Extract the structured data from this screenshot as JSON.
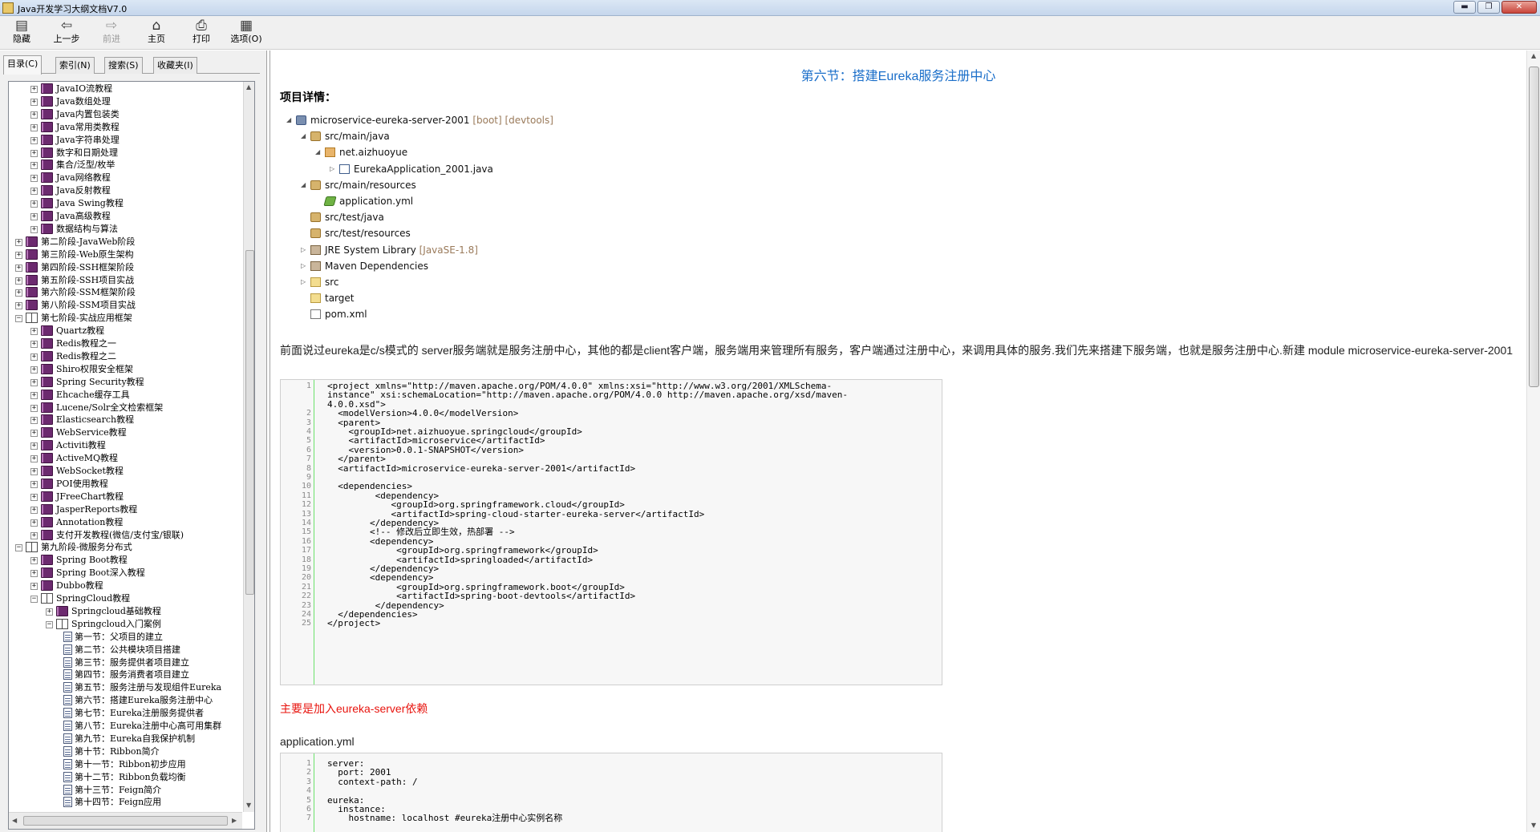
{
  "window": {
    "title": "Java开发学习大纲文档V7.0",
    "controls": {
      "minimize": "▬",
      "maximize": "❐",
      "close": "✕"
    }
  },
  "toolbar": {
    "buttons": [
      {
        "label": "隐藏",
        "icon": "hide-icon",
        "glyph": "▤",
        "enabled": true
      },
      {
        "label": "上一步",
        "icon": "back-arrow-icon",
        "glyph": "⇦",
        "enabled": true
      },
      {
        "label": "前进",
        "icon": "forward-arrow-icon",
        "glyph": "⇨",
        "enabled": false
      },
      {
        "label": "主页",
        "icon": "home-icon",
        "glyph": "⌂",
        "enabled": true
      },
      {
        "label": "打印",
        "icon": "print-icon",
        "glyph": "⎙",
        "enabled": true
      },
      {
        "label": "选项(O)",
        "icon": "options-icon",
        "glyph": "▦",
        "enabled": true
      }
    ]
  },
  "nav": {
    "tabs": [
      {
        "label": "目录(C)",
        "active": true
      },
      {
        "label": "索引(N)",
        "active": false
      },
      {
        "label": "搜索(S)",
        "active": false
      },
      {
        "label": "收藏夹(I)",
        "active": false
      }
    ],
    "tree": [
      {
        "label": "JavaIO流教程",
        "level": 1,
        "type": "closed"
      },
      {
        "label": "Java数组处理",
        "level": 1,
        "type": "closed"
      },
      {
        "label": "Java内置包装类",
        "level": 1,
        "type": "closed"
      },
      {
        "label": "Java常用类教程",
        "level": 1,
        "type": "closed"
      },
      {
        "label": "Java字符串处理",
        "level": 1,
        "type": "closed"
      },
      {
        "label": "数字和日期处理",
        "level": 1,
        "type": "closed"
      },
      {
        "label": "集合/泛型/枚举",
        "level": 1,
        "type": "closed"
      },
      {
        "label": "Java网络教程",
        "level": 1,
        "type": "closed"
      },
      {
        "label": "Java反射教程",
        "level": 1,
        "type": "closed"
      },
      {
        "label": "Java Swing教程",
        "level": 1,
        "type": "closed"
      },
      {
        "label": "Java高级教程",
        "level": 1,
        "type": "closed"
      },
      {
        "label": "数据结构与算法",
        "level": 1,
        "type": "closed"
      },
      {
        "label": "第二阶段-JavaWeb阶段",
        "level": 0,
        "type": "closed"
      },
      {
        "label": "第三阶段-Web原生架构",
        "level": 0,
        "type": "closed"
      },
      {
        "label": "第四阶段-SSH框架阶段",
        "level": 0,
        "type": "closed"
      },
      {
        "label": "第五阶段-SSH项目实战",
        "level": 0,
        "type": "closed"
      },
      {
        "label": "第六阶段-SSM框架阶段",
        "level": 0,
        "type": "closed"
      },
      {
        "label": "第八阶段-SSM项目实战",
        "level": 0,
        "type": "closed"
      },
      {
        "label": "第七阶段-实战应用框架",
        "level": 0,
        "type": "open"
      },
      {
        "label": "Quartz教程",
        "level": 1,
        "type": "closed"
      },
      {
        "label": "Redis教程之一",
        "level": 1,
        "type": "closed"
      },
      {
        "label": "Redis教程之二",
        "level": 1,
        "type": "closed"
      },
      {
        "label": "Shiro权限安全框架",
        "level": 1,
        "type": "closed"
      },
      {
        "label": "Spring Security教程",
        "level": 1,
        "type": "closed"
      },
      {
        "label": "Ehcache缓存工具",
        "level": 1,
        "type": "closed"
      },
      {
        "label": "Lucene/Solr全文检索框架",
        "level": 1,
        "type": "closed"
      },
      {
        "label": "Elasticsearch教程",
        "level": 1,
        "type": "closed"
      },
      {
        "label": "WebService教程",
        "level": 1,
        "type": "closed"
      },
      {
        "label": "Activiti教程",
        "level": 1,
        "type": "closed"
      },
      {
        "label": "ActiveMQ教程",
        "level": 1,
        "type": "closed"
      },
      {
        "label": "WebSocket教程",
        "level": 1,
        "type": "closed"
      },
      {
        "label": "POI使用教程",
        "level": 1,
        "type": "closed"
      },
      {
        "label": "JFreeChart教程",
        "level": 1,
        "type": "closed"
      },
      {
        "label": "JasperReports教程",
        "level": 1,
        "type": "closed"
      },
      {
        "label": "Annotation教程",
        "level": 1,
        "type": "closed"
      },
      {
        "label": "支付开发教程(微信/支付宝/银联)",
        "level": 1,
        "type": "closed"
      },
      {
        "label": "第九阶段-微服务分布式",
        "level": 0,
        "type": "open"
      },
      {
        "label": "Spring Boot教程",
        "level": 1,
        "type": "closed"
      },
      {
        "label": "Spring Boot深入教程",
        "level": 1,
        "type": "closed"
      },
      {
        "label": "Dubbo教程",
        "level": 1,
        "type": "closed"
      },
      {
        "label": "SpringCloud教程",
        "level": 1,
        "type": "open"
      },
      {
        "label": "Springcloud基础教程",
        "level": 2,
        "type": "closed"
      },
      {
        "label": "Springcloud入门案例",
        "level": 2,
        "type": "open"
      },
      {
        "label": "第一节：父项目的建立",
        "level": 3,
        "type": "page"
      },
      {
        "label": "第二节：公共模块项目搭建",
        "level": 3,
        "type": "page"
      },
      {
        "label": "第三节：服务提供者项目建立",
        "level": 3,
        "type": "page"
      },
      {
        "label": "第四节：服务消费者项目建立",
        "level": 3,
        "type": "page"
      },
      {
        "label": "第五节：服务注册与发现组件Eureka",
        "level": 3,
        "type": "page"
      },
      {
        "label": "第六节：搭建Eureka服务注册中心",
        "level": 3,
        "type": "page"
      },
      {
        "label": "第七节：Eureka注册服务提供者",
        "level": 3,
        "type": "page"
      },
      {
        "label": "第八节：Eureka注册中心高可用集群",
        "level": 3,
        "type": "page"
      },
      {
        "label": "第九节：Eureka自我保护机制",
        "level": 3,
        "type": "page"
      },
      {
        "label": "第十节：Ribbon简介",
        "level": 3,
        "type": "page"
      },
      {
        "label": "第十一节：Ribbon初步应用",
        "level": 3,
        "type": "page"
      },
      {
        "label": "第十二节：Ribbon负载均衡",
        "level": 3,
        "type": "page"
      },
      {
        "label": "第十三节：Feign简介",
        "level": 3,
        "type": "page"
      },
      {
        "label": "第十四节：Feign应用",
        "level": 3,
        "type": "page"
      }
    ]
  },
  "content": {
    "section_title": "第六节：搭建Eureka服务注册中心",
    "detail_label": "项目详情：",
    "project_tree": [
      {
        "label": "microservice-eureka-server-2001",
        "suffix": " [boot] [devtools]",
        "level": 0,
        "twisty": "◢",
        "icon": "project-icon",
        "cls": "proj"
      },
      {
        "label": "src/main/java",
        "suffix": "",
        "level": 1,
        "twisty": "◢",
        "icon": "source-folder-icon",
        "cls": "srcf"
      },
      {
        "label": "net.aizhuoyue",
        "suffix": "",
        "level": 2,
        "twisty": "◢",
        "icon": "package-icon",
        "cls": "pkg"
      },
      {
        "label": "EurekaApplication_2001.java",
        "suffix": "",
        "level": 3,
        "twisty": "▷",
        "icon": "java-file-icon",
        "cls": "java"
      },
      {
        "label": "src/main/resources",
        "suffix": "",
        "level": 1,
        "twisty": "◢",
        "icon": "source-folder-icon",
        "cls": "srcf"
      },
      {
        "label": "application.yml",
        "suffix": "",
        "level": 2,
        "twisty": "",
        "icon": "yml-file-icon",
        "cls": "yml"
      },
      {
        "label": "src/test/java",
        "suffix": "",
        "level": 1,
        "twisty": "",
        "icon": "source-folder-icon",
        "cls": "srcf"
      },
      {
        "label": "src/test/resources",
        "suffix": "",
        "level": 1,
        "twisty": "",
        "icon": "source-folder-icon",
        "cls": "srcf"
      },
      {
        "label": "JRE System Library",
        "suffix": " [JavaSE-1.8]",
        "level": 1,
        "twisty": "▷",
        "icon": "library-icon",
        "cls": "lib"
      },
      {
        "label": "Maven Dependencies",
        "suffix": "",
        "level": 1,
        "twisty": "▷",
        "icon": "library-icon",
        "cls": "lib"
      },
      {
        "label": "src",
        "suffix": "",
        "level": 1,
        "twisty": "▷",
        "icon": "folder-icon",
        "cls": "fold"
      },
      {
        "label": "target",
        "suffix": "",
        "level": 1,
        "twisty": "",
        "icon": "folder-icon",
        "cls": "fold"
      },
      {
        "label": "pom.xml",
        "suffix": "",
        "level": 1,
        "twisty": "",
        "icon": "xml-file-icon",
        "cls": "xml"
      }
    ],
    "paragraph": "前面说过eureka是c/s模式的  server服务端就是服务注册中心，其他的都是client客户端，服务端用来管理所有服务，客户端通过注册中心，来调用具体的服务.我们先来搭建下服务端，也就是服务注册中心.新建  module   microservice-eureka-server-2001",
    "pom_code": [
      "<project xmlns=\"http://maven.apache.org/POM/4.0.0\" xmlns:xsi=\"http://www.w3.org/2001/XMLSchema-",
      "instance\" xsi:schemaLocation=\"http://maven.apache.org/POM/4.0.0 http://maven.apache.org/xsd/maven-",
      "4.0.0.xsd\">",
      "  <modelVersion>4.0.0</modelVersion>",
      "  <parent>",
      "    <groupId>net.aizhuoyue.springcloud</groupId>",
      "    <artifactId>microservice</artifactId>",
      "    <version>0.0.1-SNAPSHOT</version>",
      "  </parent>",
      "  <artifactId>microservice-eureka-server-2001</artifactId>",
      "",
      "  <dependencies>",
      "         <dependency>",
      "            <groupId>org.springframework.cloud</groupId>",
      "            <artifactId>spring-cloud-starter-eureka-server</artifactId>",
      "        </dependency>",
      "        <!-- 修改后立即生效，热部署 -->",
      "        <dependency>",
      "             <groupId>org.springframework</groupId>",
      "             <artifactId>springloaded</artifactId>",
      "        </dependency>",
      "        <dependency>",
      "             <groupId>org.springframework.boot</groupId>",
      "             <artifactId>spring-boot-devtools</artifactId>",
      "         </dependency>",
      "  </dependencies>",
      "</project>"
    ],
    "pom_line_numbers": [
      "1",
      "",
      "",
      "2",
      "3",
      "4",
      "5",
      "6",
      "7",
      "8",
      "9",
      "10",
      "11",
      "12",
      "13",
      "14",
      "15",
      "16",
      "17",
      "18",
      "19",
      "20",
      "21",
      "22",
      "23",
      "24",
      "25"
    ],
    "red_note": "主要是加入eureka-server依赖",
    "yml_label": "application.yml",
    "yml_code": [
      "server:",
      "  port: 2001",
      "  context-path: /",
      "",
      "eureka:",
      "  instance:",
      "    hostname: localhost #eureka注册中心实例名称"
    ],
    "yml_line_numbers": [
      "1",
      "2",
      "3",
      "4",
      "5",
      "6",
      "7"
    ]
  },
  "colors": {
    "section_title": "#1a6ec9",
    "red_note": "#e8140e",
    "xml_tag": "#a11a1a",
    "xml_string": "#1a1aa6",
    "xml_comment": "#008200"
  }
}
